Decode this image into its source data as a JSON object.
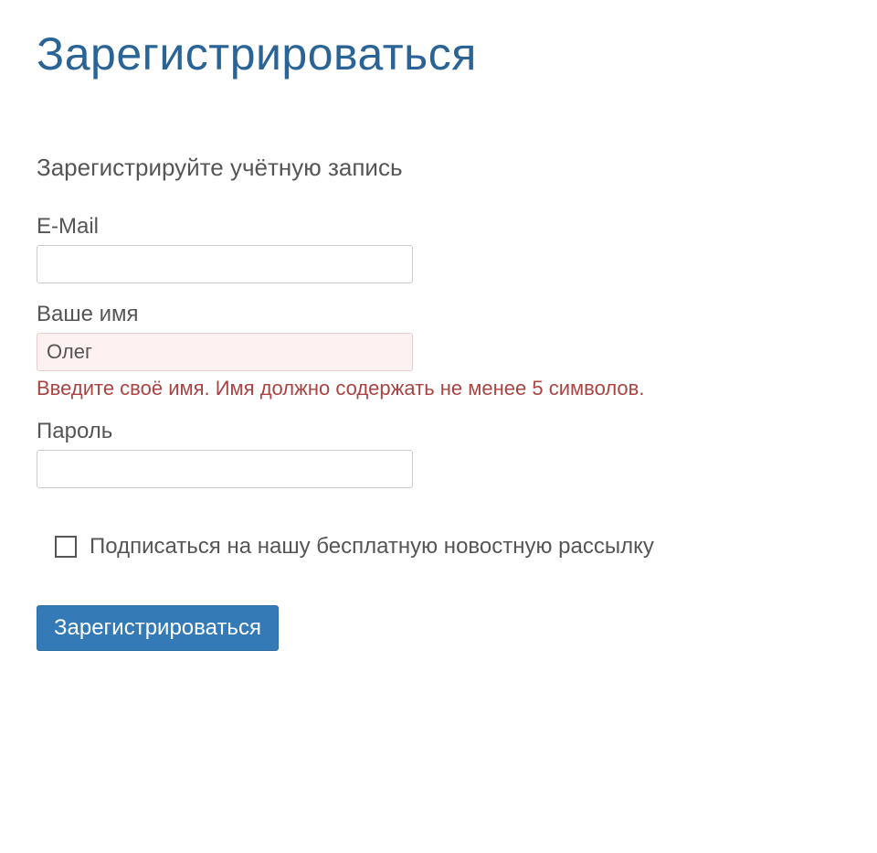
{
  "page": {
    "title": "Зарегистрироваться",
    "subtitle": "Зарегистрируйте учётную запись"
  },
  "form": {
    "email_label": "E-Mail",
    "email_value": "",
    "name_label": "Ваше имя",
    "name_value": "Олег",
    "name_error": "Введите своё имя. Имя должно содержать не менее 5 символов.",
    "password_label": "Пароль",
    "password_value": "",
    "newsletter_label": "Подписаться на нашу бесплатную новостную рассылку",
    "submit_label": "Зарегистрироваться"
  }
}
